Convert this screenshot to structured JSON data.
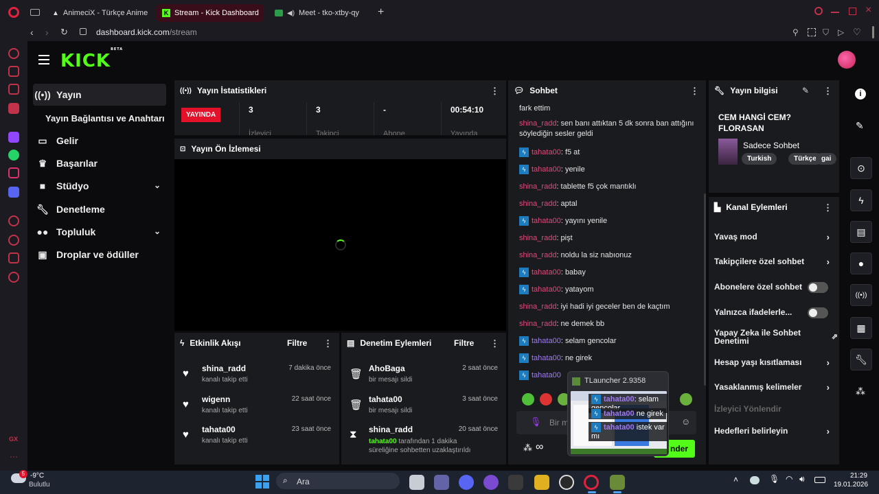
{
  "browser": {
    "tabs": [
      {
        "title": "AnimeciX - Türkçe Anime"
      },
      {
        "title": "Stream - Kick Dashboard"
      },
      {
        "title": "Meet - tko-xtby-qy"
      }
    ],
    "url_domain": "dashboard.kick.com",
    "url_path": "/stream"
  },
  "kick": {
    "logo": "KICK",
    "logo_badge": "BETA"
  },
  "nav": {
    "items": [
      {
        "label": "Yayın",
        "icon": "broadcast-icon"
      },
      {
        "label": "Yayın Bağlantısı ve Anahtarı",
        "icon": ""
      },
      {
        "label": "Gelir",
        "icon": "wallet-icon"
      },
      {
        "label": "Başarılar",
        "icon": "trophy-icon"
      },
      {
        "label": "Stüdyo",
        "icon": "video-icon"
      },
      {
        "label": "Denetleme",
        "icon": "wrench-icon"
      },
      {
        "label": "Topluluk",
        "icon": "users-icon"
      },
      {
        "label": "Droplar ve ödüller",
        "icon": "gift-icon"
      }
    ]
  },
  "stats": {
    "title": "Yayın İstatistikleri",
    "live_badge": "YAYINDA",
    "items": [
      {
        "value": "3",
        "label": "İzleyici"
      },
      {
        "value": "3",
        "label": "Takipçi"
      },
      {
        "value": "-",
        "label": "Abone"
      },
      {
        "value": "00:54:10",
        "label": "Yayında"
      }
    ]
  },
  "preview": {
    "title": "Yayın Ön İzlemesi"
  },
  "activity": {
    "title": "Etkinlik Akışı",
    "filter": "Filtre",
    "items": [
      {
        "name": "shina_radd",
        "sub": "kanalı takip etti",
        "time": "7 dakika önce"
      },
      {
        "name": "wigenn",
        "sub": "kanalı takip etti",
        "time": "22 saat önce"
      },
      {
        "name": "tahata00",
        "sub": "kanalı takip etti",
        "time": "23 saat önce"
      }
    ]
  },
  "moderation": {
    "title": "Denetim Eylemleri",
    "filter": "Filtre",
    "items": [
      {
        "name": "AhoBaga",
        "sub": "bir mesajı sildi",
        "time": "2 saat önce"
      },
      {
        "name": "tahata00",
        "sub": "bir mesajı sildi",
        "time": "3 saat önce"
      },
      {
        "name": "shina_radd",
        "sub_user": "tahata00",
        "sub": "tarafından 1 dakika süreliğine sohbetten uzaklaştırıldı",
        "time": "20 saat önce"
      }
    ]
  },
  "chat": {
    "title": "Sohbet",
    "messages": [
      {
        "user": "",
        "text": "fark ettim",
        "color": "",
        "badge": false
      },
      {
        "user": "shina_radd",
        "text": ": sen banı attıktan 5 dk sonra ban attığını söylediğin sesler geldi",
        "color": "pink",
        "badge": false
      },
      {
        "user": "tahata00",
        "text": ": f5 at",
        "color": "pink",
        "badge": true
      },
      {
        "user": "tahata00",
        "text": ": yenile",
        "color": "pink",
        "badge": true
      },
      {
        "user": "shina_radd",
        "text": ": tablette f5 çok mantıklı",
        "color": "pink",
        "badge": false
      },
      {
        "user": "shina_radd",
        "text": ": aptal",
        "color": "pink",
        "badge": false
      },
      {
        "user": "tahata00",
        "text": ": yayını yenile",
        "color": "pink",
        "badge": true
      },
      {
        "user": "shina_radd",
        "text": ": pişt",
        "color": "pink",
        "badge": false
      },
      {
        "user": "shina_radd",
        "text": ": noldu la siz nabıonuz",
        "color": "pink",
        "badge": false
      },
      {
        "user": "tahata00",
        "text": ": babay",
        "color": "pink",
        "badge": true
      },
      {
        "user": "tahata00",
        "text": ": yatayom",
        "color": "pink",
        "badge": true
      },
      {
        "user": "shina_radd",
        "text": ": iyi hadi iyi geceler ben de kaçtım",
        "color": "pink",
        "badge": false
      },
      {
        "user": "shina_radd",
        "text": ": ne demek bb",
        "color": "pink",
        "badge": false
      },
      {
        "user": "tahata00",
        "text": ": selam gencolar",
        "color": "purple",
        "badge": true
      },
      {
        "user": "tahata00",
        "text": ": ne girek",
        "color": "purple",
        "badge": true
      },
      {
        "user": "tahata00",
        "text": "",
        "color": "purple",
        "badge": true
      }
    ],
    "input_placeholder": "Bir m",
    "send_label": "nder"
  },
  "popup": {
    "title": "TLauncher 2.9358",
    "lines": [
      {
        "user": "tahata00",
        "text": ": selam gencolar"
      },
      {
        "user": "tahata00",
        "text": "ne girek"
      },
      {
        "user": "tahata00",
        "text": "istek var mı"
      }
    ]
  },
  "stream_info": {
    "title": "Yayın bilgisi",
    "stream_title": "CEM HANGİ CEM? FLORASAN",
    "category": "Sadece Sohbet",
    "tags": [
      "Turkish",
      "Türkçe",
      "gai"
    ]
  },
  "channel_actions": {
    "title": "Kanal Eylemleri",
    "items": [
      {
        "label": "Yavaş mod",
        "kind": "arrow"
      },
      {
        "label": "Takipçilere özel sohbet",
        "kind": "arrow"
      },
      {
        "label": "Abonelere özel sohbet",
        "kind": "toggle"
      },
      {
        "label": "Yalnızca ifadelerle...",
        "kind": "toggle"
      },
      {
        "label": "Yapay Zeka ile Sohbet Denetimi",
        "kind": "external"
      },
      {
        "label": "Hesap yaşı kısıtlaması",
        "kind": "arrow"
      },
      {
        "label": "Yasaklanmış kelimeler",
        "kind": "arrow"
      },
      {
        "label": "İzleyici Yönlendir",
        "kind": "heading"
      },
      {
        "label": "Hedefleri belirleyin",
        "kind": "arrow"
      }
    ]
  },
  "taskbar": {
    "weather_temp": "-9°C",
    "weather_text": "Bulutlu",
    "search": "Ara",
    "time": "21:29",
    "date": "19.01.2026"
  },
  "colors": {
    "kick_green": "#53fc18",
    "live_red": "#e4112b",
    "tab_active": "#3a0d1a"
  }
}
